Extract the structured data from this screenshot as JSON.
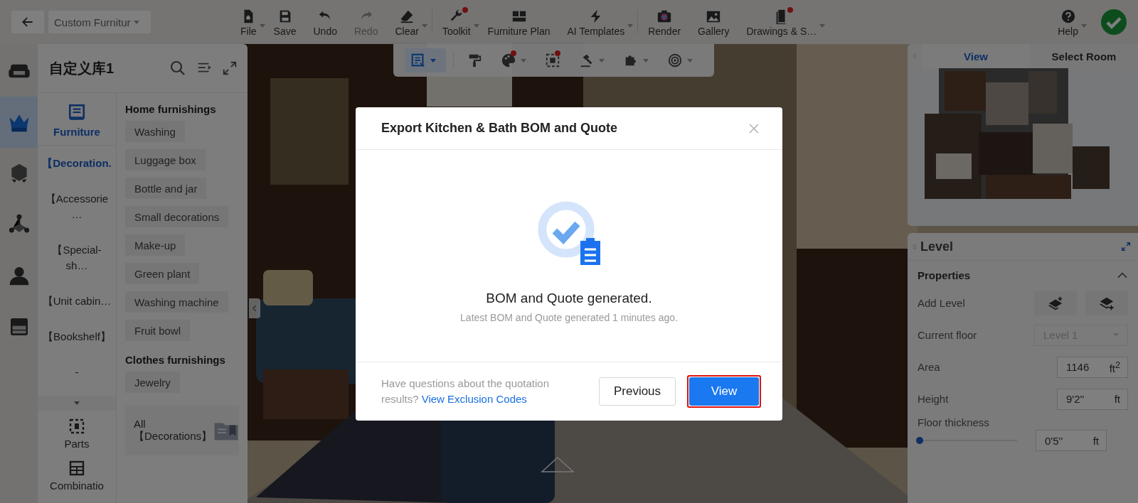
{
  "top_bar": {
    "project_dropdown": "Custom Furnitur",
    "tool_groups": [
      {
        "tools": [
          {
            "label": "File",
            "dropdown": true,
            "badge": false,
            "disabled": false
          },
          {
            "label": "Save",
            "dropdown": false,
            "badge": false,
            "disabled": false
          },
          {
            "label": "Undo",
            "dropdown": false,
            "badge": false,
            "disabled": false
          },
          {
            "label": "Redo",
            "dropdown": false,
            "badge": false,
            "disabled": true
          },
          {
            "label": "Clear",
            "dropdown": true,
            "badge": false,
            "disabled": false
          }
        ]
      },
      {
        "tools": [
          {
            "label": "Toolkit",
            "dropdown": true,
            "badge": true,
            "disabled": false
          },
          {
            "label": "Furniture Plan",
            "dropdown": false,
            "badge": false,
            "disabled": false
          },
          {
            "label": "AI Templates",
            "dropdown": true,
            "badge": false,
            "disabled": false
          }
        ]
      },
      {
        "tools": [
          {
            "label": "Render",
            "dropdown": false,
            "badge": false,
            "disabled": false
          },
          {
            "label": "Gallery",
            "dropdown": false,
            "badge": false,
            "disabled": false
          },
          {
            "label": "Drawings & S…",
            "dropdown": true,
            "badge": true,
            "disabled": false
          }
        ]
      }
    ],
    "help": {
      "label": "Help",
      "dropdown": true
    }
  },
  "float_toolbar": {
    "tools": [
      {
        "selected": true,
        "dropdown": true,
        "badge": false
      },
      {
        "selected": false,
        "dropdown": false,
        "badge": false
      },
      {
        "selected": false,
        "dropdown": true,
        "badge": true
      },
      {
        "selected": false,
        "dropdown": false,
        "badge": true
      },
      {
        "selected": false,
        "dropdown": true,
        "badge": false
      },
      {
        "selected": false,
        "dropdown": true,
        "badge": false
      },
      {
        "selected": false,
        "dropdown": true,
        "badge": false
      }
    ]
  },
  "left_rail": {
    "items": [
      {
        "selected": false
      },
      {
        "selected": true
      },
      {
        "selected": false
      },
      {
        "selected": false
      },
      {
        "selected": false
      },
      {
        "selected": false
      }
    ]
  },
  "library": {
    "title": "自定义库1",
    "tabs": [
      {
        "label": "Furniture",
        "selected": true
      }
    ],
    "categories": [
      {
        "label": "【Decoration.",
        "selected": true
      },
      {
        "label": "【Accessorie…",
        "selected": false
      },
      {
        "label": "【Special-sh…",
        "selected": false
      },
      {
        "label": "【Unit cabin…",
        "selected": false
      },
      {
        "label": "【Bookshelf】",
        "selected": false
      },
      {
        "label": "-",
        "selected": false
      }
    ],
    "bottom_tabs": [
      {
        "label": "Parts"
      },
      {
        "label": "Combinatio"
      }
    ],
    "groups": [
      {
        "heading": "Home furnishings",
        "items": [
          "Washing",
          "Luggage box",
          "Bottle and jar",
          "Small decorations",
          "Make-up",
          "Green plant",
          "Washing machine",
          "Fruit bowl"
        ]
      },
      {
        "heading": "Clothes furnishings",
        "items": [
          "Jewelry"
        ]
      }
    ],
    "all_card": "All 【Decorations】"
  },
  "minimap": {
    "tabs": [
      {
        "label": "View",
        "selected": true
      },
      {
        "label": "Select Room",
        "selected": false
      }
    ]
  },
  "level_panel": {
    "title": "Level",
    "section": {
      "title": "Properties",
      "expanded": true
    },
    "add_level": "Add Level",
    "current_floor": {
      "label": "Current floor",
      "value": "Level 1",
      "disabled": true
    },
    "area": {
      "label": "Area",
      "value": "1146",
      "unit": "ft$^{2}$"
    },
    "height": {
      "label": "Height",
      "value": "9'2''",
      "unit": "ft"
    },
    "floor_thickness": {
      "label": "Floor thickness",
      "level": 0,
      "value": "0'5''",
      "unit": "ft"
    }
  },
  "dialog": {
    "title": "Export Kitchen & Bath BOM and Quote",
    "message": "BOM and Quote generated.",
    "detail": "Latest BOM and Quote generated 1 minutes ago.",
    "help_text": "Have questions about the quotation results?",
    "help_link": "View Exclusion Codes",
    "buttons": [
      {
        "label": "Previous",
        "kind": "secondary",
        "highlighted": false
      },
      {
        "label": "View",
        "kind": "primary",
        "highlighted": true
      }
    ]
  }
}
